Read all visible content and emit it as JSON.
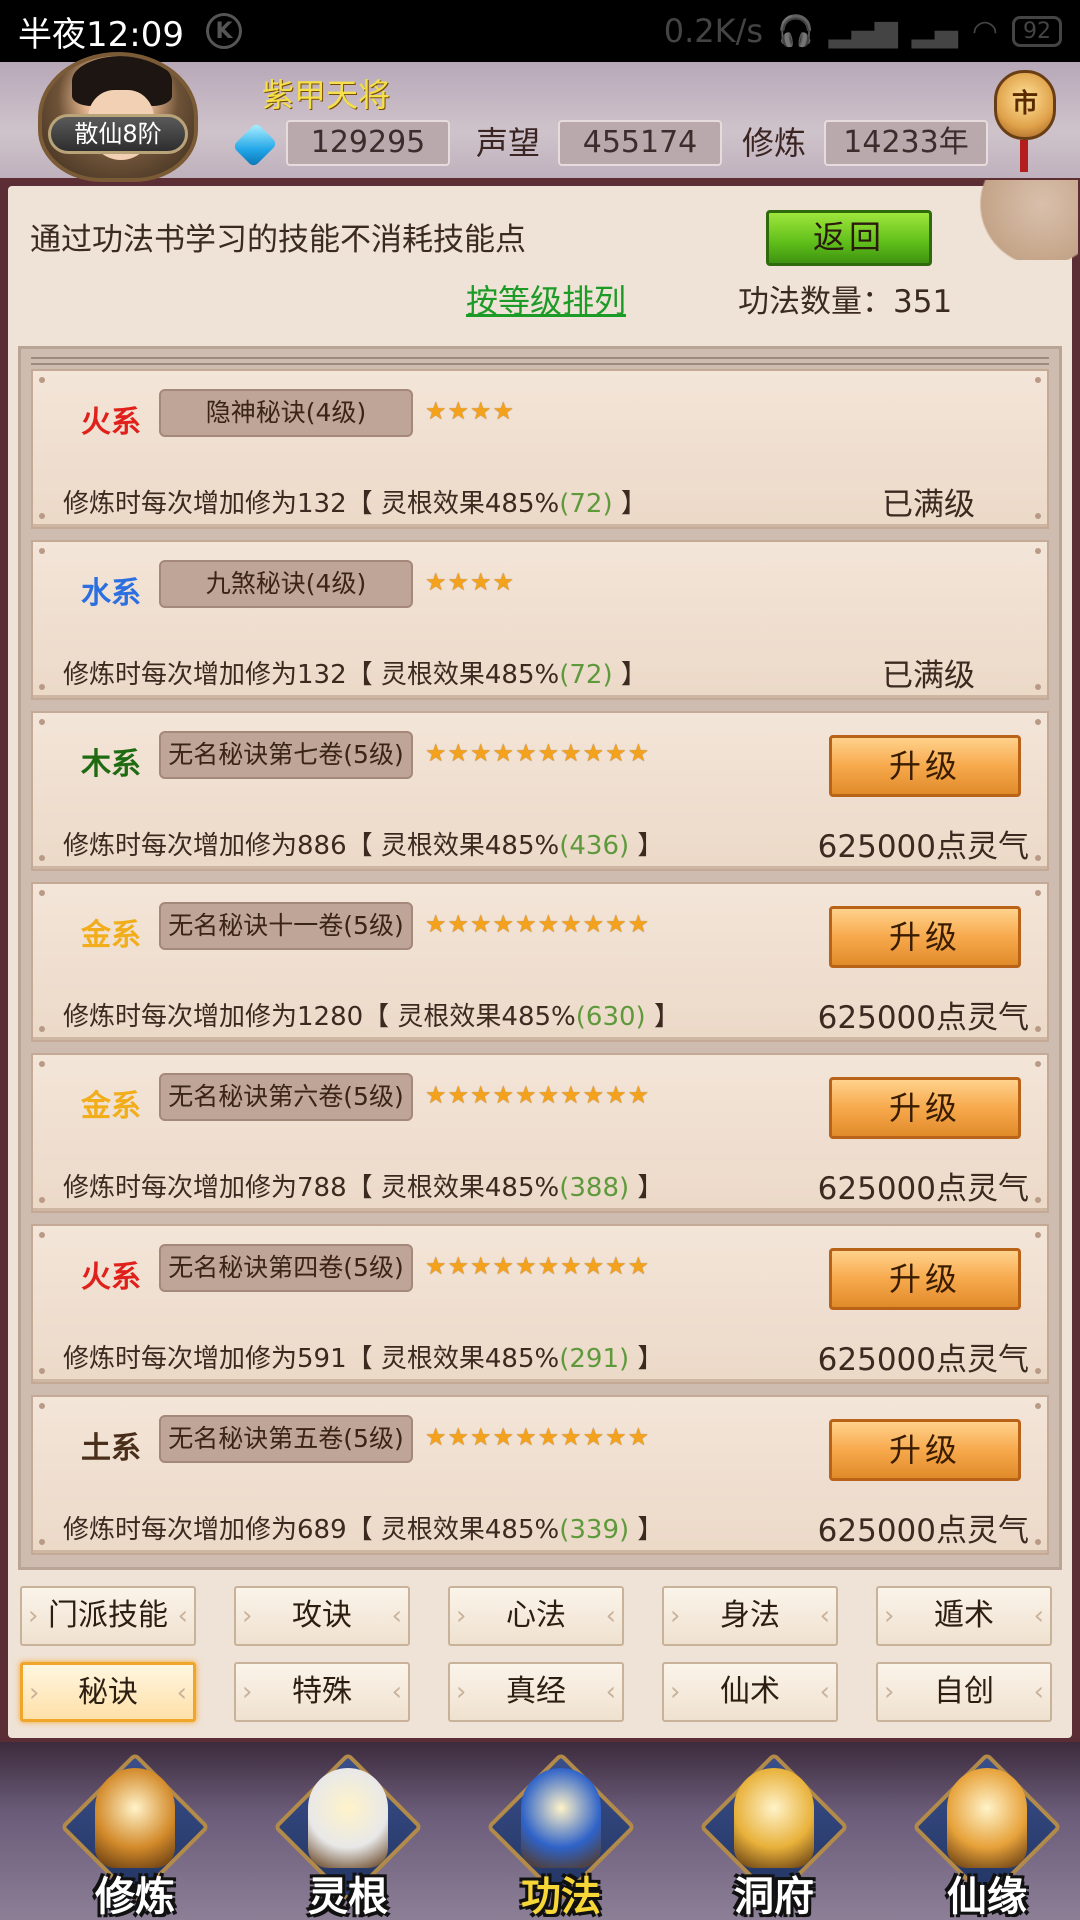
{
  "statusbar": {
    "time": "半夜12:09",
    "k_badge": "K",
    "speed": "0.2K/s",
    "battery": "92"
  },
  "header": {
    "rank": "散仙8阶",
    "name": "紫甲天将",
    "currency_value": "129295",
    "prestige_label": "声望",
    "prestige_value": "455174",
    "cultivation_label": "修炼",
    "cultivation_value": "14233年",
    "shop_glyph": "市"
  },
  "panel": {
    "info": "通过功法书学习的技能不消耗技能点",
    "back_label": "返回",
    "sort_label": "按等级排列",
    "count_label": "功法数量：351"
  },
  "skills": [
    {
      "element": "火系",
      "color": "#e0211b",
      "name": "隐神秘诀(4级)",
      "stars": 4,
      "desc_a": "修炼时每次增加修为132【 灵根效果485%",
      "desc_g": "(72)",
      "desc_b": " 】",
      "status": "已满级"
    },
    {
      "element": "水系",
      "color": "#2c6fe0",
      "name": "九煞秘诀(4级)",
      "stars": 4,
      "desc_a": "修炼时每次增加修为132【 灵根效果485%",
      "desc_g": "(72)",
      "desc_b": " 】",
      "status": "已满级"
    },
    {
      "element": "木系",
      "color": "#1f6b12",
      "name": "无名秘诀第七卷(5级)",
      "stars": 10,
      "desc_a": "修炼时每次增加修为886【 灵根效果485%",
      "desc_g": "(436)",
      "desc_b": " 】",
      "button": "升级",
      "cost": "625000点灵气"
    },
    {
      "element": "金系",
      "color": "#f1ad1a",
      "name": "无名秘诀十一卷(5级)",
      "stars": 10,
      "desc_a": "修炼时每次增加修为1280【 灵根效果485%",
      "desc_g": "(630)",
      "desc_b": " 】",
      "button": "升级",
      "cost": "625000点灵气"
    },
    {
      "element": "金系",
      "color": "#f1ad1a",
      "name": "无名秘诀第六卷(5级)",
      "stars": 10,
      "desc_a": "修炼时每次增加修为788【 灵根效果485%",
      "desc_g": "(388)",
      "desc_b": " 】",
      "button": "升级",
      "cost": "625000点灵气"
    },
    {
      "element": "火系",
      "color": "#e0211b",
      "name": "无名秘诀第四卷(5级)",
      "stars": 10,
      "desc_a": "修炼时每次增加修为591【 灵根效果485%",
      "desc_g": "(291)",
      "desc_b": " 】",
      "button": "升级",
      "cost": "625000点灵气"
    },
    {
      "element": "土系",
      "color": "#4a2e1a",
      "name": "无名秘诀第五卷(5级)",
      "stars": 10,
      "desc_a": "修炼时每次增加修为689【 灵根效果485%",
      "desc_g": "(339)",
      "desc_b": " 】",
      "button": "升级",
      "cost": "625000点灵气"
    }
  ],
  "tabs": [
    {
      "label": "门派技能",
      "active": false
    },
    {
      "label": "攻诀",
      "active": false
    },
    {
      "label": "心法",
      "active": false
    },
    {
      "label": "身法",
      "active": false
    },
    {
      "label": "遁术",
      "active": false
    },
    {
      "label": "秘诀",
      "active": true
    },
    {
      "label": "特殊",
      "active": false
    },
    {
      "label": "真经",
      "active": false
    },
    {
      "label": "仙术",
      "active": false
    },
    {
      "label": "自创",
      "active": false
    }
  ],
  "nav": [
    {
      "label": "修炼",
      "icon": "monk-icon",
      "active": false
    },
    {
      "label": "灵根",
      "icon": "yin-yang-sword-icon",
      "active": false
    },
    {
      "label": "功法",
      "icon": "book-icon",
      "active": true
    },
    {
      "label": "洞府",
      "icon": "pagoda-icon",
      "active": false
    },
    {
      "label": "仙缘",
      "icon": "gourd-icon",
      "active": false
    }
  ]
}
